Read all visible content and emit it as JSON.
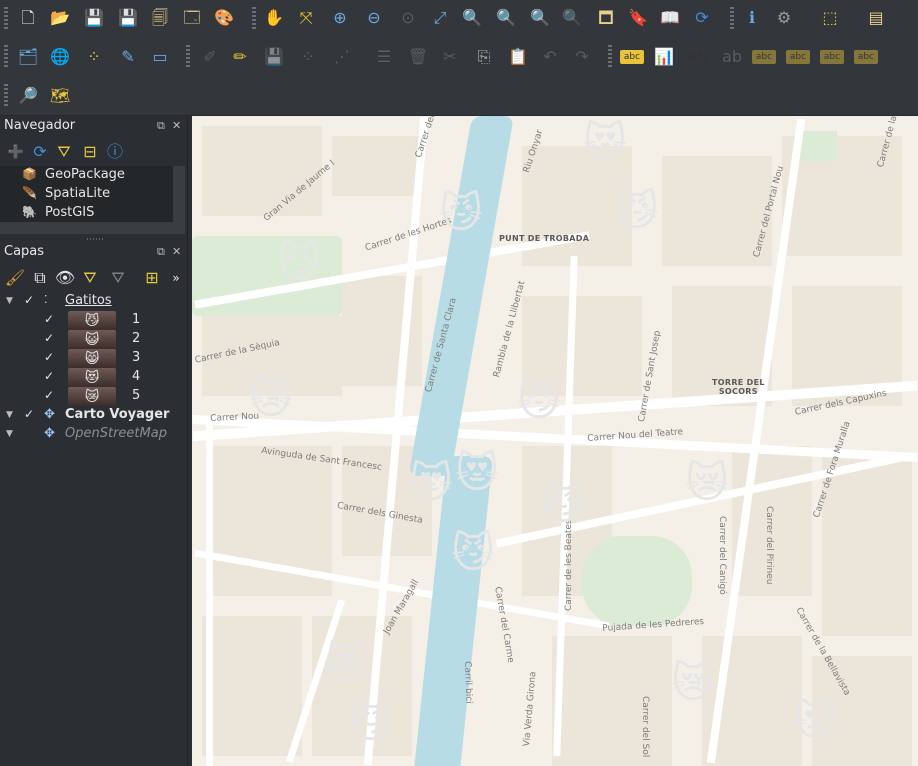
{
  "toolbar": {
    "row1": [
      {
        "name": "new-project-icon",
        "glyph": "🗋"
      },
      {
        "name": "open-project-icon",
        "glyph": "📂"
      },
      {
        "name": "save-project-icon",
        "glyph": "💾"
      },
      {
        "name": "save-as-icon",
        "glyph": "💾"
      },
      {
        "name": "new-print-layout-icon",
        "glyph": "🗐"
      },
      {
        "name": "layout-manager-icon",
        "glyph": "🗔"
      },
      {
        "name": "style-manager-icon",
        "glyph": "🎨"
      },
      {
        "name": "pan-map-icon",
        "glyph": "✋"
      },
      {
        "name": "pan-to-selection-icon",
        "glyph": "⤧"
      },
      {
        "name": "zoom-in-icon",
        "glyph": "⊕"
      },
      {
        "name": "zoom-out-icon",
        "glyph": "⊖"
      },
      {
        "name": "zoom-native-icon",
        "glyph": "⊙"
      },
      {
        "name": "zoom-full-icon",
        "glyph": "⤢"
      },
      {
        "name": "zoom-to-selection-icon",
        "glyph": "🔍"
      },
      {
        "name": "zoom-to-layer-icon",
        "glyph": "🔍"
      },
      {
        "name": "zoom-last-icon",
        "glyph": "🔍"
      },
      {
        "name": "zoom-next-icon",
        "glyph": "🔍"
      },
      {
        "name": "new-map-view-icon",
        "glyph": "🗖"
      },
      {
        "name": "new-bookmark-icon",
        "glyph": "🔖"
      },
      {
        "name": "show-bookmarks-icon",
        "glyph": "📖"
      },
      {
        "name": "refresh-icon",
        "glyph": "⟳"
      },
      {
        "name": "identify-features-icon",
        "glyph": "ℹ"
      },
      {
        "name": "run-action-icon",
        "glyph": "⚙"
      },
      {
        "name": "select-features-icon",
        "glyph": "⬚"
      },
      {
        "name": "attribute-table-icon",
        "glyph": "▤"
      }
    ],
    "row2": [
      {
        "name": "data-source-manager-icon",
        "glyph": "🗂"
      },
      {
        "name": "new-layer-icon",
        "glyph": "🌐"
      },
      {
        "name": "digitize-points-icon",
        "glyph": "⁘"
      },
      {
        "name": "digitize-line-icon",
        "glyph": "✎"
      },
      {
        "name": "new-shapefile-icon",
        "glyph": "▭"
      },
      {
        "name": "edit-toggle-icon",
        "glyph": "✐"
      },
      {
        "name": "pencil-icon",
        "glyph": "✏"
      },
      {
        "name": "save-edits-icon",
        "glyph": "💾"
      },
      {
        "name": "add-feature-icon",
        "glyph": "⁘"
      },
      {
        "name": "vertex-tool-icon",
        "glyph": "⋰"
      },
      {
        "name": "modify-attributes-icon",
        "glyph": "☰"
      },
      {
        "name": "delete-selected-icon",
        "glyph": "🗑"
      },
      {
        "name": "cut-features-icon",
        "glyph": "✂"
      },
      {
        "name": "copy-features-icon",
        "glyph": "⎘"
      },
      {
        "name": "paste-features-icon",
        "glyph": "📋"
      },
      {
        "name": "undo-icon",
        "glyph": "↶"
      },
      {
        "name": "redo-icon",
        "glyph": "↷"
      },
      {
        "name": "label-toolbar-icon",
        "glyph": "abc"
      },
      {
        "name": "diagram-icon",
        "glyph": "📊"
      },
      {
        "name": "pin-labels-icon",
        "glyph": "ab"
      },
      {
        "name": "show-labels-icon",
        "glyph": "ab"
      },
      {
        "name": "move-label-icon",
        "glyph": "abc"
      },
      {
        "name": "rotate-label-icon",
        "glyph": "abc"
      },
      {
        "name": "change-label-icon",
        "glyph": "abc"
      },
      {
        "name": "label-properties-icon",
        "glyph": "abc"
      }
    ],
    "row3": [
      {
        "name": "search-map-icon",
        "glyph": "🔎"
      },
      {
        "name": "georeferencer-icon",
        "glyph": "🗺"
      }
    ]
  },
  "browser": {
    "title": "Navegador",
    "items": [
      {
        "label": "GeoPackage",
        "icon": "geopackage-icon",
        "glyph": "📦"
      },
      {
        "label": "SpatiaLite",
        "icon": "spatialite-icon",
        "glyph": "🪶"
      },
      {
        "label": "PostGIS",
        "icon": "postgis-icon",
        "glyph": "🐘"
      }
    ]
  },
  "layers": {
    "title": "Capas",
    "group_gatitos": "Gatitos",
    "classes": [
      {
        "label": "1",
        "glyph": "😼"
      },
      {
        "label": "2",
        "glyph": "😺"
      },
      {
        "label": "3",
        "glyph": "😸"
      },
      {
        "label": "4",
        "glyph": "😻"
      },
      {
        "label": "5",
        "glyph": "😿"
      }
    ],
    "carto": "Carto Voyager",
    "osm": "OpenStreetMap"
  },
  "map": {
    "place_labels": [
      "PUNT DE TROBADA",
      "TORRE DEL\nSOCORS"
    ],
    "streets": [
      "Carrer del Nord",
      "Gran Via de Jaume I",
      "Carrer de les Hortes",
      "Riu Onyar",
      "Carrer de la Muralla",
      "Carrer del Portal Nou",
      "Carrer de la Sèquia",
      "Carrer de Santa Clara",
      "Rambla de la Llibertat",
      "Carrer de Sant Josep",
      "Carrer Nou",
      "Avinguda de Sant Francesc",
      "Carrer Nou del Teatre",
      "Carrer dels Capuxins",
      "Carrer de Fora Muralla",
      "Carrer dels Ginesta",
      "Carrer de les Beates",
      "Carrer del Pirineu",
      "Carrer del Canigó",
      "Carrer del Carme",
      "Pujada de les Pedreres",
      "Carrer de la Bellavista",
      "Joan Maragall",
      "Carril bici",
      "Via Verda Girona",
      "Carrer del Sol"
    ],
    "cats": [
      {
        "glyph": "😻"
      },
      {
        "glyph": "😼"
      },
      {
        "glyph": "😼"
      },
      {
        "glyph": "😼"
      },
      {
        "glyph": "😿"
      },
      {
        "glyph": "😼"
      },
      {
        "glyph": "😻"
      },
      {
        "glyph": "😻"
      },
      {
        "glyph": "😼"
      },
      {
        "glyph": "😿"
      },
      {
        "glyph": "😼"
      },
      {
        "glyph": "😻"
      },
      {
        "glyph": "😼"
      },
      {
        "glyph": "😿"
      },
      {
        "glyph": "😻"
      }
    ]
  }
}
